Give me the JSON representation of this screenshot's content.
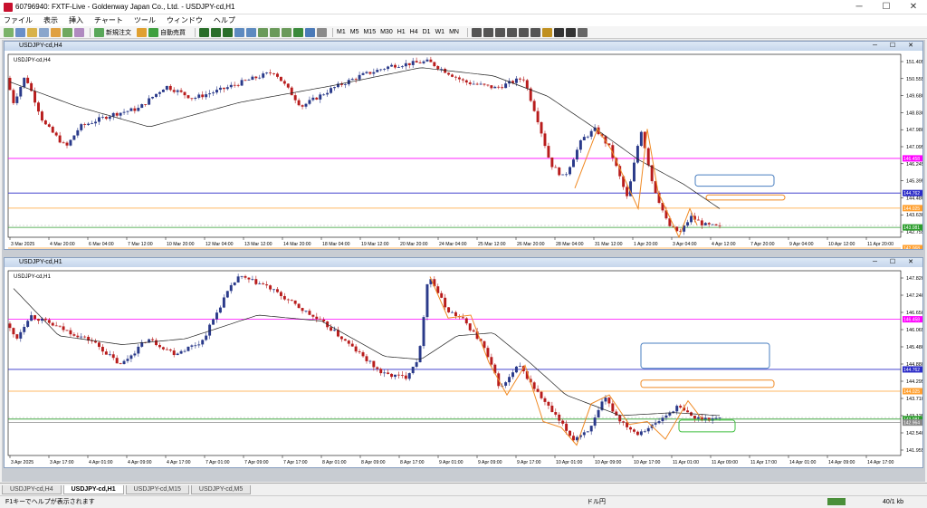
{
  "window": {
    "title": "60796940: FXTF-Live - Goldenway Japan Co., Ltd. - USDJPY-cd,H1"
  },
  "menu": [
    "ファイル",
    "表示",
    "挿入",
    "チャート",
    "ツール",
    "ウィンドウ",
    "ヘルプ"
  ],
  "toolbar": {
    "new_order": "新規注文",
    "auto_trade": "自動売買",
    "timeframes": [
      "M1",
      "M5",
      "M15",
      "M30",
      "H1",
      "H4",
      "D1",
      "W1",
      "MN"
    ]
  },
  "colors": {
    "bull": "#2a3a8a",
    "bear": "#b81c1c",
    "ma": "#222222",
    "swing": "#f08a24",
    "magenta": "#ff00ff",
    "blue_line": "#2c2cc8",
    "orange_line": "#ffa030",
    "green_line": "#2e9e2e",
    "box_blue": "#4a7fc0",
    "box_orange": "#f08a24",
    "box_green": "#3fbf3f"
  },
  "charts": [
    {
      "title": "USDJPY-cd,H4",
      "symbol_label": "USDJPY-cd,H4",
      "price_labels": [
        "151.405",
        "150.555",
        "149.680",
        "148.830",
        "147.980",
        "147.095",
        "146.245",
        "145.395",
        "144.480",
        "143.630",
        "142.755"
      ],
      "level_tags": [
        {
          "price": 146.458,
          "text": "146.458",
          "color": "#ff00ff"
        },
        {
          "price": 144.762,
          "text": "144.762",
          "color": "#2c2cc8"
        },
        {
          "price": 144.025,
          "text": "144.025",
          "color": "#ffa030"
        },
        {
          "price": 143.081,
          "text": "143.081",
          "color": "#2e9e2e"
        },
        {
          "price": 142.068,
          "text": "142.068",
          "color": "#ffa030"
        }
      ],
      "time_labels": [
        "3 Mar 2025",
        "4 Mar 20:00",
        "6 Mar 04:00",
        "7 Mar 12:00",
        "10 Mar 20:00",
        "12 Mar 04:00",
        "13 Mar 12:00",
        "14 Mar 20:00",
        "18 Mar 04:00",
        "19 Mar 12:00",
        "20 Mar 20:00",
        "24 Mar 04:00",
        "25 Mar 12:00",
        "26 Mar 20:00",
        "28 Mar 04:00",
        "31 Mar 12:00",
        "1 Apr 20:00",
        "3 Apr 04:00",
        "4 Apr 12:00",
        "7 Apr 20:00",
        "9 Apr 04:00",
        "10 Apr 12:00",
        "11 Apr 20:00"
      ]
    },
    {
      "title": "USDJPY-cd,H1",
      "symbol_label": "USDJPY-cd,H1",
      "price_labels": [
        "147.820",
        "147.240",
        "146.650",
        "146.065",
        "145.480",
        "144.880",
        "144.295",
        "143.710",
        "143.125",
        "142.540",
        "141.955"
      ],
      "level_tags": [
        {
          "price": 146.458,
          "text": "146.458",
          "color": "#ff00ff"
        },
        {
          "price": 144.762,
          "text": "144.762",
          "color": "#2c2cc8"
        },
        {
          "price": 144.025,
          "text": "144.025",
          "color": "#ffa030"
        },
        {
          "price": 143.081,
          "text": "143.081",
          "color": "#2e9e2e"
        },
        {
          "price": 142.964,
          "text": "142.964",
          "color": "#888888"
        }
      ],
      "time_labels": [
        "3 Apr 2025",
        "3 Apr 17:00",
        "4 Apr 01:00",
        "4 Apr 09:00",
        "4 Apr 17:00",
        "7 Apr 01:00",
        "7 Apr 09:00",
        "7 Apr 17:00",
        "8 Apr 01:00",
        "8 Apr 09:00",
        "8 Apr 17:00",
        "9 Apr 01:00",
        "9 Apr 09:00",
        "9 Apr 17:00",
        "10 Apr 01:00",
        "10 Apr 09:00",
        "10 Apr 17:00",
        "11 Apr 01:00",
        "11 Apr 09:00",
        "11 Apr 17:00",
        "14 Apr 01:00",
        "14 Apr 09:00",
        "14 Apr 17:00"
      ]
    }
  ],
  "tabs": [
    "USDJPY-cd,H4",
    "USDJPY-cd,H1",
    "USDJPY-cd,M15",
    "USDJPY-cd,M5"
  ],
  "active_tab": 1,
  "status": {
    "help": "F1キーでヘルプが表示されます",
    "mode": "ドル円",
    "traffic": "40/1 kb"
  }
}
